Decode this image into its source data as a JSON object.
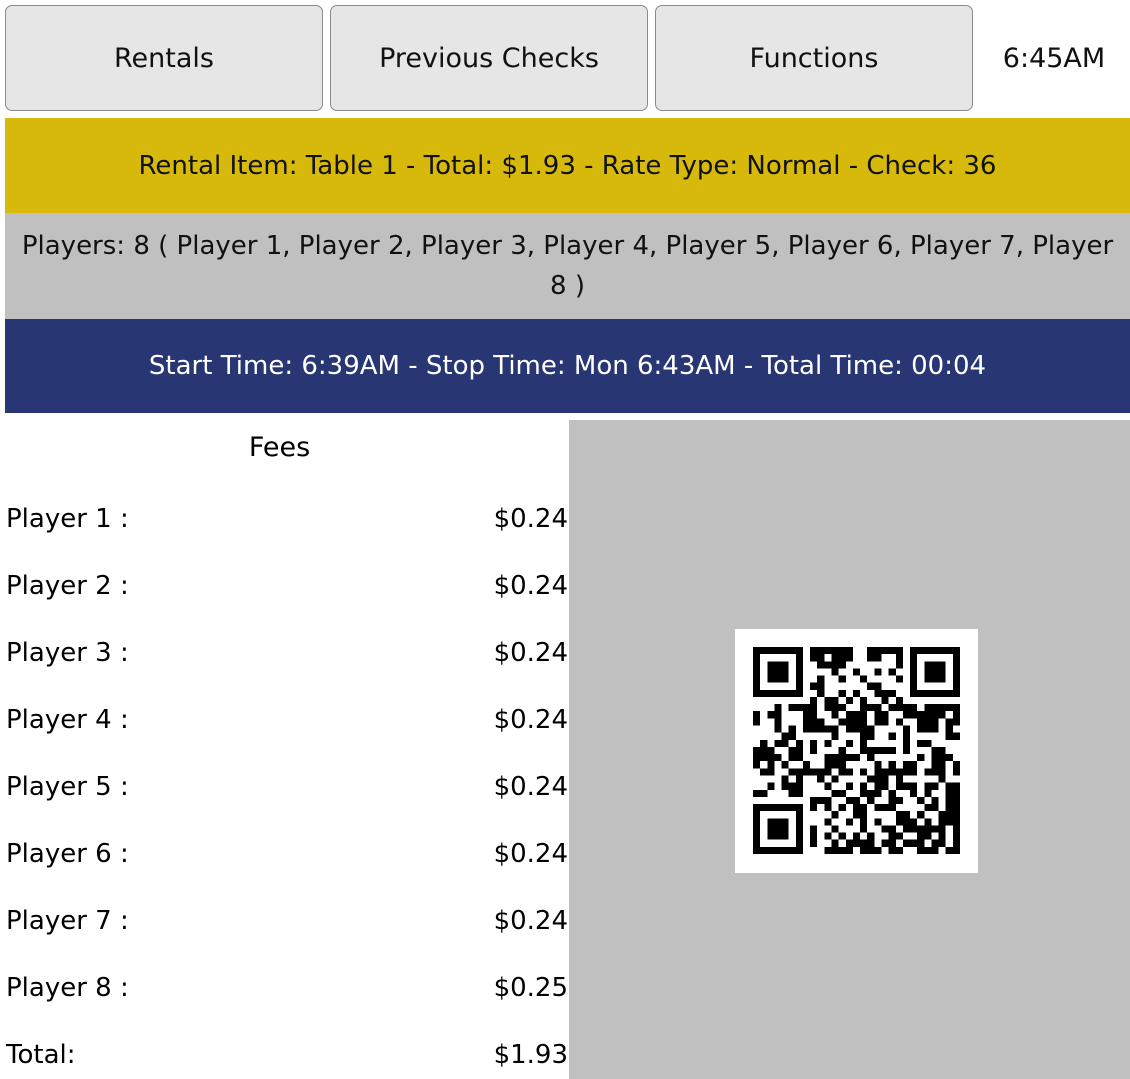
{
  "header": {
    "rentals_label": "Rentals",
    "previous_checks_label": "Previous Checks",
    "functions_label": "Functions",
    "time": "6:45AM"
  },
  "rental_info": "Rental Item: Table 1 - Total: $1.93 - Rate Type: Normal - Check: 36",
  "players_info": "Players: 8 ( Player 1, Player 2, Player 3, Player 4, Player 5, Player 6, Player 7, Player 8 )",
  "time_info": "Start Time: 6:39AM - Stop Time: Mon 6:43AM - Total Time: 00:04",
  "fees": {
    "title": "Fees",
    "rows": [
      {
        "label": "Player 1 :",
        "amount": "$0.24"
      },
      {
        "label": "Player 2 :",
        "amount": "$0.24"
      },
      {
        "label": "Player 3 :",
        "amount": "$0.24"
      },
      {
        "label": "Player 4 :",
        "amount": "$0.24"
      },
      {
        "label": "Player 5 :",
        "amount": "$0.24"
      },
      {
        "label": "Player 6 :",
        "amount": "$0.24"
      },
      {
        "label": "Player 7 :",
        "amount": "$0.24"
      },
      {
        "label": "Player 8 :",
        "amount": "$0.25"
      }
    ],
    "total_label": "Total:",
    "total_amount": "$1.93"
  },
  "colors": {
    "rental_bar": "#d6b90a",
    "players_bar": "#c0c0c0",
    "time_bar": "#283674",
    "button_bg": "#e6e6e6"
  }
}
